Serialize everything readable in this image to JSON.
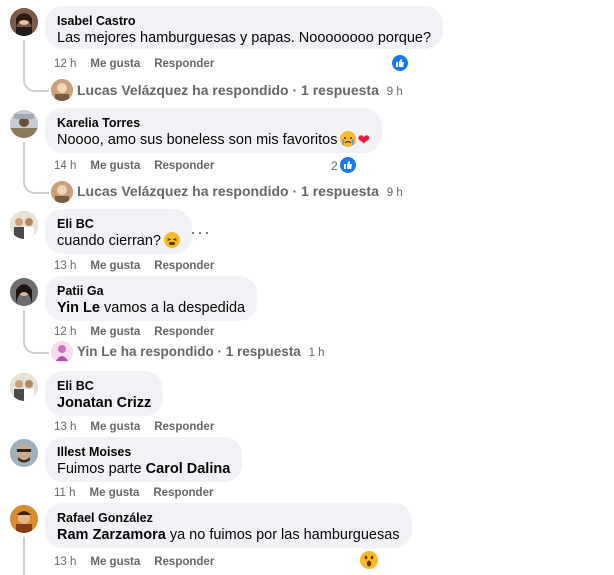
{
  "actions": {
    "like": "Me gusta",
    "reply": "Responder"
  },
  "comments": [
    {
      "author": "Isabel Castro",
      "text": "Las mejores hamburguesas y papas. Noooooooo porque?",
      "time": "12 h",
      "reactions": {
        "type": "like",
        "count": ""
      },
      "reply_summary": {
        "name": "Lucas Velázquez ha respondido",
        "count": "· 1 respuesta",
        "time": "9 h"
      }
    },
    {
      "author": "Karelia Torres",
      "text": "Noooo, amo sus boneless son mis favoritos",
      "emoji": "crying-face-and-heart",
      "time": "14 h",
      "reactions": {
        "type": "like",
        "count": "2"
      },
      "reply_summary": {
        "name": "Lucas Velázquez ha respondido",
        "count": "· 1 respuesta",
        "time": "9 h"
      }
    },
    {
      "author": "Eli BC",
      "text": "cuando cierran?",
      "emoji": "tired-face",
      "more": "···",
      "time": "13 h"
    },
    {
      "author": "Patii Ga",
      "mention": "Yin Le",
      "text": "vamos a la despedida",
      "time": "12 h",
      "reply_summary": {
        "name": "Yin Le ha respondido",
        "count": "· 1 respuesta",
        "time": "1 h"
      }
    },
    {
      "author": "Eli BC",
      "mention": "Jonatan Crizz",
      "time": "13 h"
    },
    {
      "author": "Illest Moises",
      "text": "Fuimos parte",
      "mention": "Carol Dalina",
      "time": "11 h"
    },
    {
      "author": "Rafael González",
      "mention": "Ram Zarzamora",
      "text": "ya no fuimos por las hamburguesas",
      "time": "13 h",
      "reactions": {
        "type": "wow",
        "count": ""
      }
    }
  ]
}
